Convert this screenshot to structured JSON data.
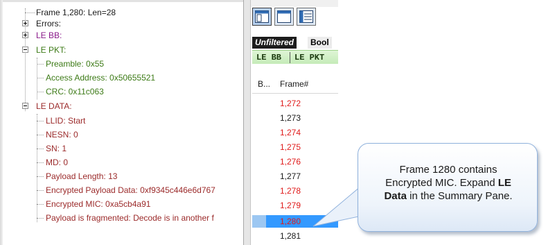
{
  "decode_tree": {
    "rows": [
      {
        "label": "Frame 1,280:  Len=28"
      },
      {
        "label": "Errors:"
      },
      {
        "label": "LE BB:"
      },
      {
        "label": "LE PKT:"
      },
      {
        "label": "Preamble: 0x55"
      },
      {
        "label": "Access Address: 0x50655521"
      },
      {
        "label": "CRC: 0x11c063"
      },
      {
        "label": "LE DATA:"
      },
      {
        "label": "LLID: Start"
      },
      {
        "label": "NESN: 0"
      },
      {
        "label": "SN: 1"
      },
      {
        "label": "MD: 0"
      },
      {
        "label": "Payload Length: 13"
      },
      {
        "label": "Encrypted Payload Data: 0xf9345c446e6d767"
      },
      {
        "label": "Encrypted MIC: 0xa5cb4a91"
      },
      {
        "label": "Payload is fragmented: Decode is in another f"
      }
    ]
  },
  "summary": {
    "filter_tabs": [
      "Unfiltered",
      "Bool"
    ],
    "protocol_tabs": [
      "LE BB",
      "LE PKT"
    ],
    "columns": [
      "B...",
      "Frame#"
    ],
    "frames": [
      {
        "number": "1,272"
      },
      {
        "number": "1,273"
      },
      {
        "number": "1,274"
      },
      {
        "number": "1,275"
      },
      {
        "number": "1,276"
      },
      {
        "number": "1,277"
      },
      {
        "number": "1,278"
      },
      {
        "number": "1,279"
      },
      {
        "number": "1,280"
      },
      {
        "number": "1,281"
      }
    ]
  },
  "callout": {
    "line1": "Frame 1280 contains",
    "line2": "Encrypted MIC.  Expand ",
    "line2_bold": "LE",
    "line3_bold": "Data",
    "line3": " in the Summary Pane."
  },
  "colors": {
    "error_red": "#e01b1b",
    "selection_blue": "#3399ff",
    "pkt_green": "#3c7a16",
    "data_red": "#9b2a2a",
    "bb_purple": "#8a1a8a"
  },
  "icons": [
    "expand-minus-icon",
    "expand-plus-icon",
    "pane-layout-icon",
    "window-icon",
    "list-icon"
  ]
}
